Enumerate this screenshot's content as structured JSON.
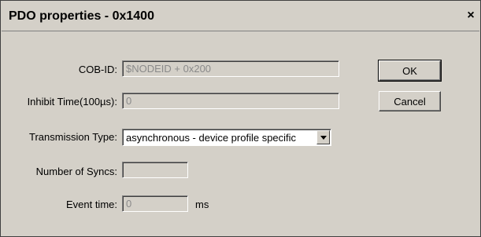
{
  "window": {
    "title": "PDO properties - 0x1400",
    "close_label": "×"
  },
  "form": {
    "cob_id": {
      "label": "COB-ID:",
      "value": "$NODEID + 0x200"
    },
    "inhibit_time": {
      "label": "Inhibit Time(100µs):",
      "value": "0"
    },
    "transmission_type": {
      "label": "Transmission Type:",
      "value": "asynchronous - device profile specific"
    },
    "number_of_syncs": {
      "label": "Number of Syncs:",
      "value": ""
    },
    "event_time": {
      "label": "Event time:",
      "value": "0",
      "unit": "ms"
    }
  },
  "buttons": {
    "ok": "OK",
    "cancel": "Cancel"
  },
  "icons": {
    "close": "close-icon",
    "dropdown": "chevron-down-icon"
  }
}
